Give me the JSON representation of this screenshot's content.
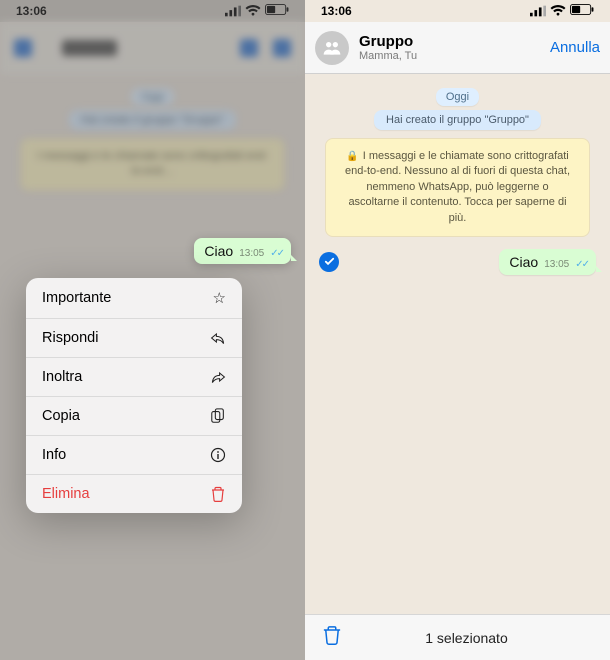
{
  "status": {
    "time": "13:06"
  },
  "left": {
    "message": {
      "text": "Ciao",
      "time": "13:05"
    },
    "menu": {
      "important": "Importante",
      "reply": "Rispondi",
      "forward": "Inoltra",
      "copy": "Copia",
      "info": "Info",
      "delete": "Elimina"
    }
  },
  "right": {
    "header": {
      "title": "Gruppo",
      "subtitle": "Mamma, Tu",
      "cancel": "Annulla"
    },
    "date": "Oggi",
    "system_msg": "Hai creato il gruppo \"Gruppo\"",
    "encryption": "I messaggi e le chiamate sono crittografati end-to-end. Nessuno al di fuori di questa chat, nemmeno WhatsApp, può leggerne o ascoltarne il contenuto. Tocca per saperne di più.",
    "message": {
      "text": "Ciao",
      "time": "13:05"
    },
    "toolbar": {
      "count": "1 selezionato"
    }
  }
}
